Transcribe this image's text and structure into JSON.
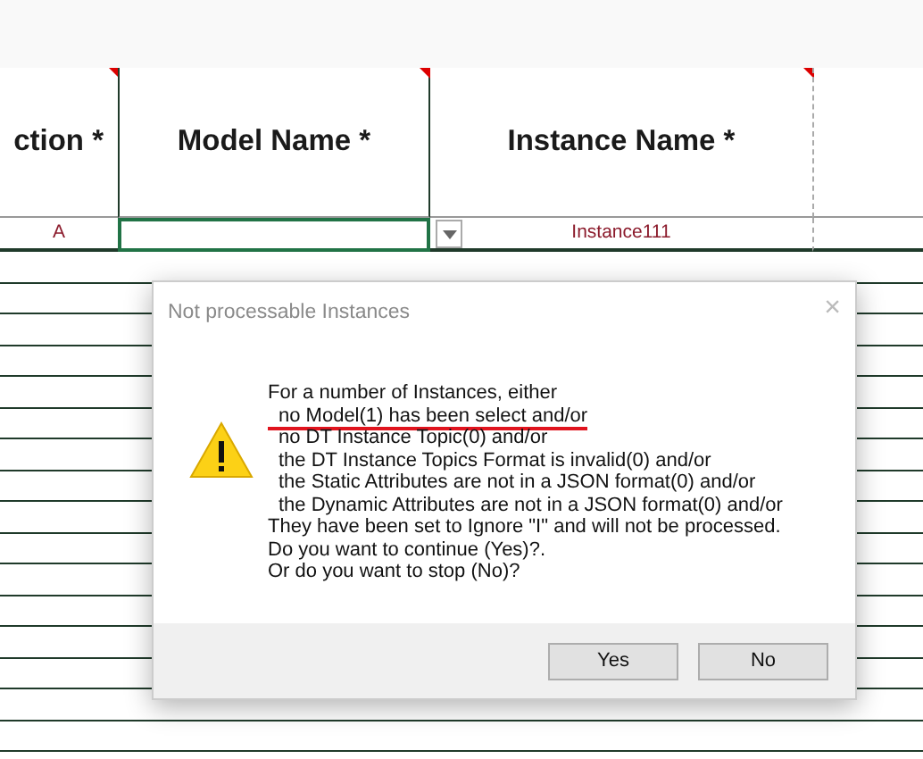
{
  "sheet": {
    "columns": [
      {
        "header": "ction *",
        "flagged": true
      },
      {
        "header": "Model Name *",
        "flagged": true
      },
      {
        "header": "Instance Name *",
        "flagged": true
      }
    ],
    "row": [
      {
        "text": "A",
        "selected": false
      },
      {
        "selected": true,
        "dropdown": true
      },
      {
        "text": "Instance111",
        "selected": false
      }
    ]
  },
  "dialog": {
    "title": "Not processable Instances",
    "close": "×",
    "lines": [
      {
        "text": "For a number of Instances, either",
        "kind": "main",
        "underlined": false
      },
      {
        "text": "no Model(1) has been select and/or",
        "kind": "sub",
        "underlined": true
      },
      {
        "text": "no DT Instance Topic(0) and/or",
        "kind": "sub",
        "underlined": false
      },
      {
        "text": "the DT Instance Topics Format is invalid(0) and/or",
        "kind": "sub",
        "underlined": false
      },
      {
        "text": "the Static Attributes are not in a JSON format(0) and/or",
        "kind": "sub",
        "underlined": false
      },
      {
        "text": "the Dynamic Attributes are not in a JSON format(0) and/or",
        "kind": "sub",
        "underlined": false
      },
      {
        "text": "They have been set to Ignore \"I\" and will not be processed.",
        "kind": "main",
        "underlined": false
      },
      {
        "text": "Do you want to continue (Yes)?.",
        "kind": "main",
        "underlined": false
      },
      {
        "text": "Or do you want to stop (No)?",
        "kind": "main",
        "underlined": false
      }
    ],
    "buttons": [
      "Yes",
      "No"
    ]
  }
}
